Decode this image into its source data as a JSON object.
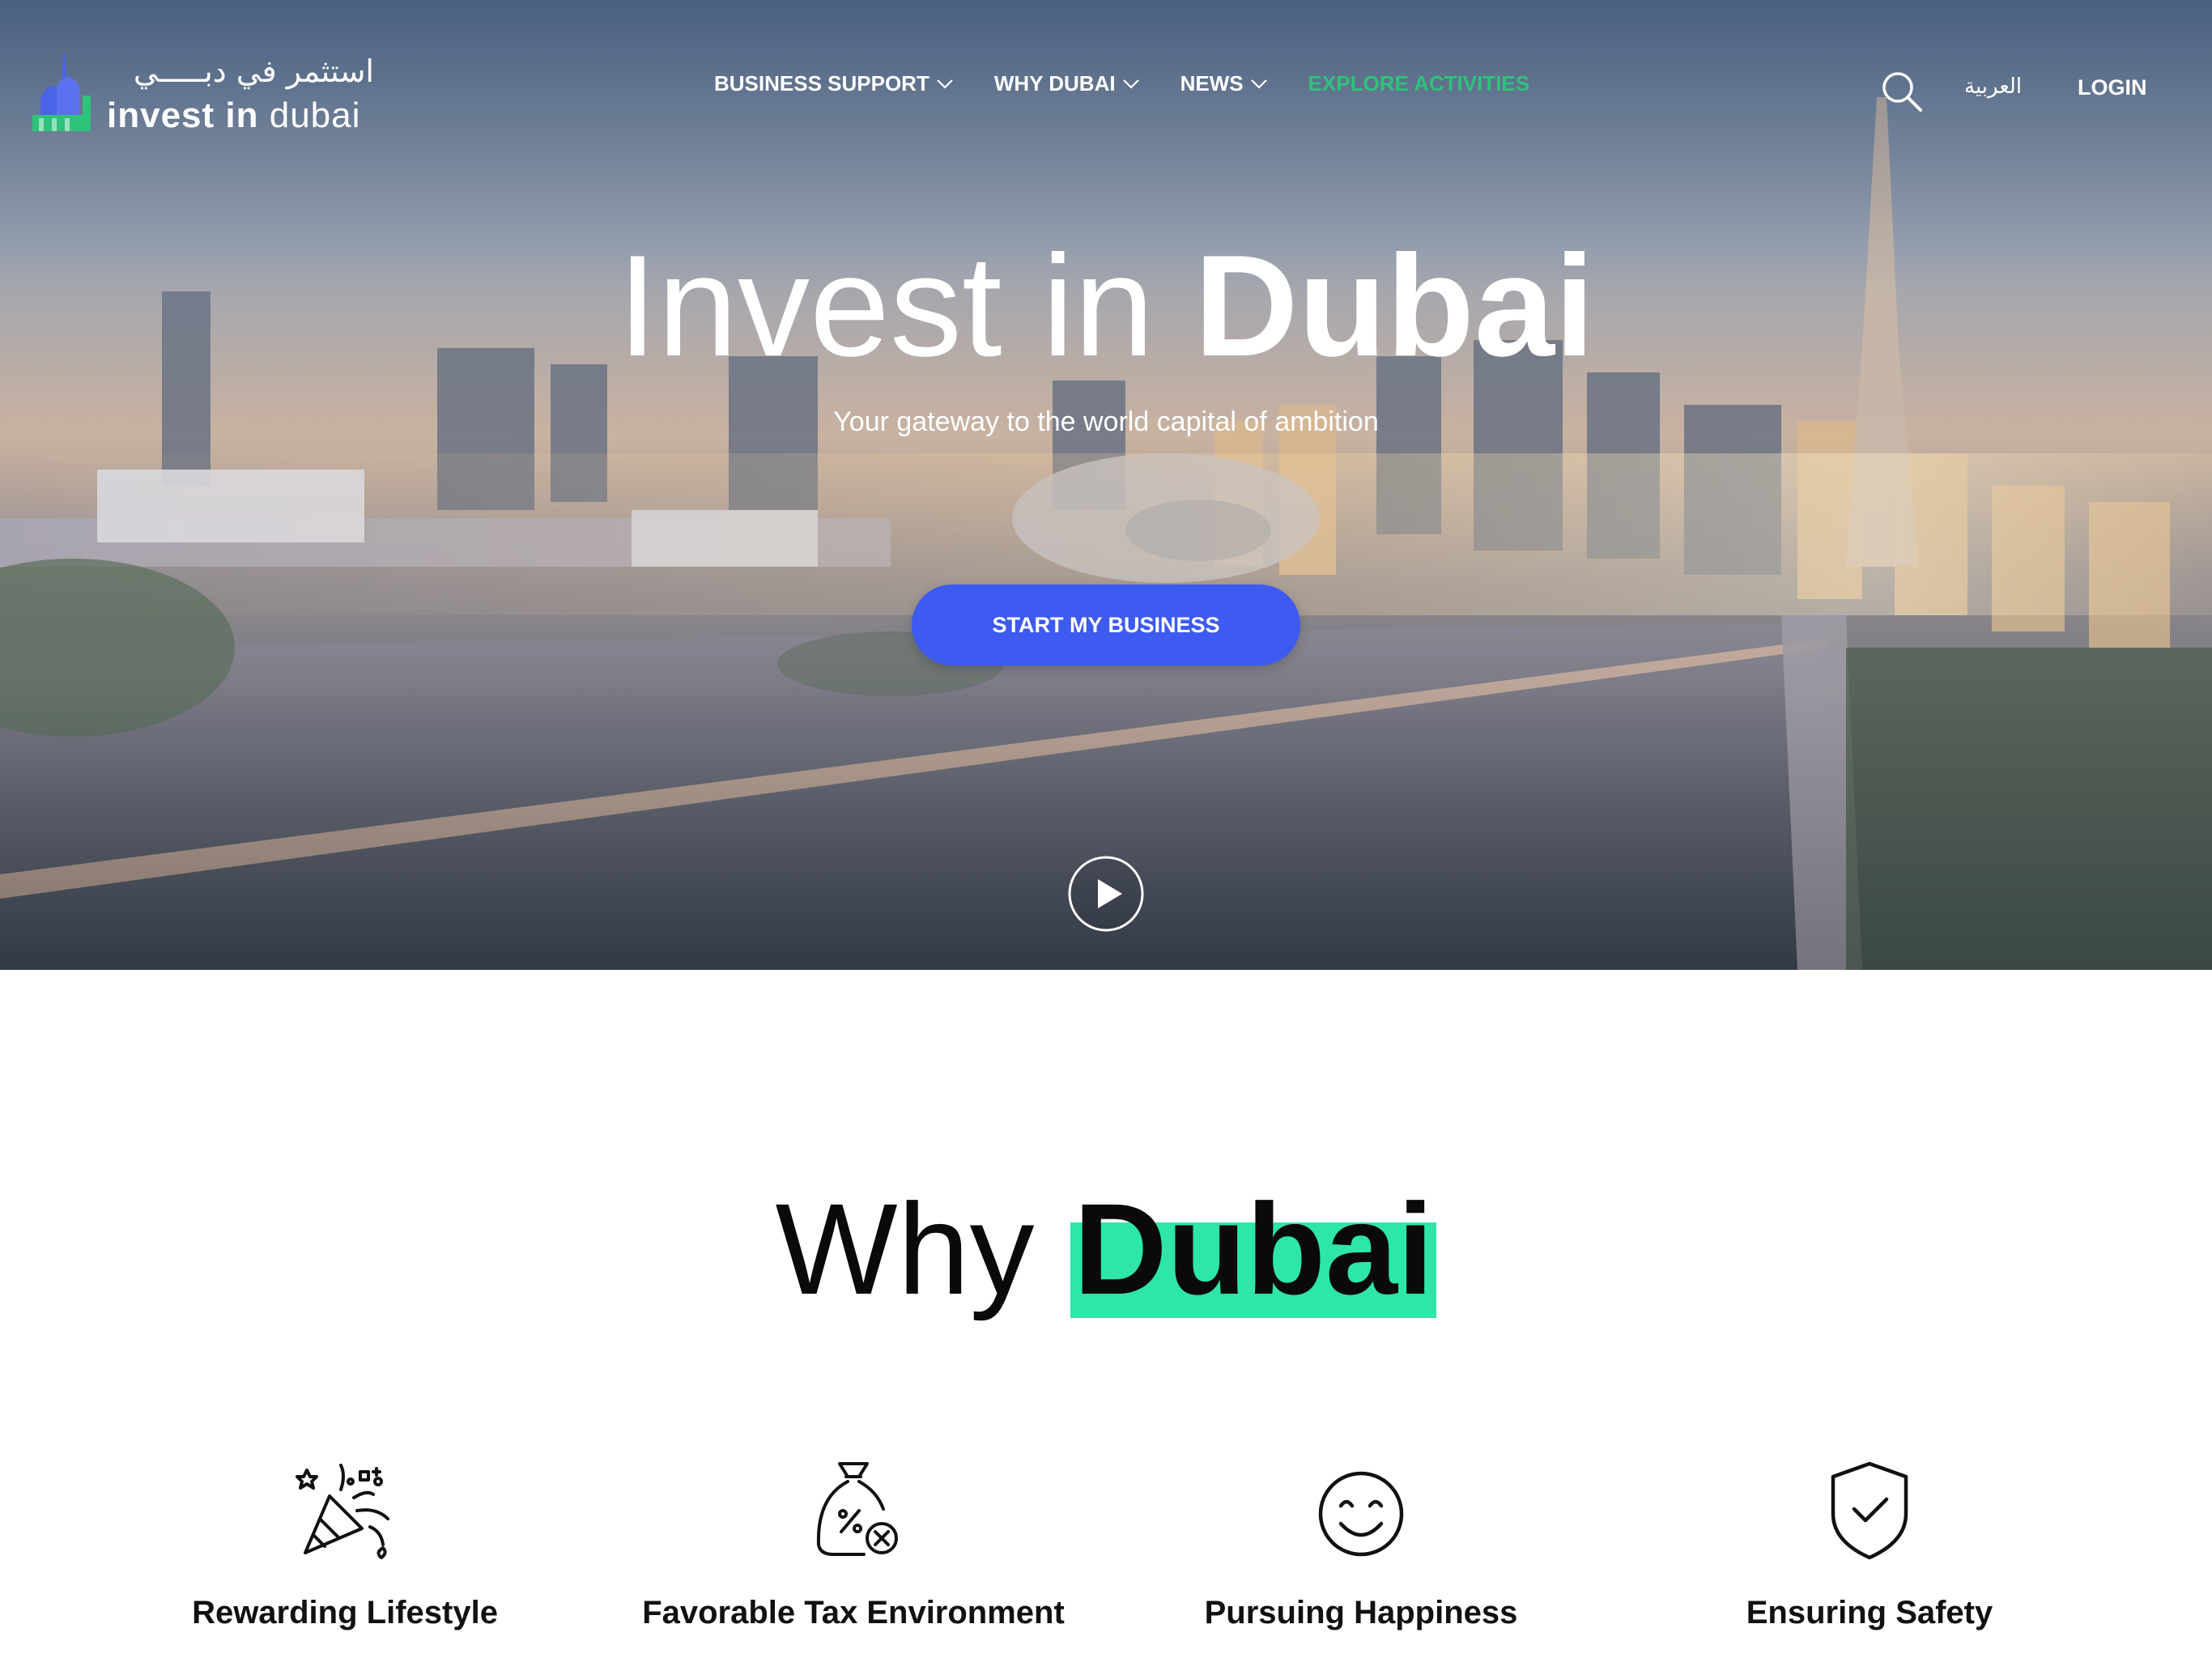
{
  "header": {
    "logo_arabic": "استثمر في دبـــــي",
    "logo_english_strong": "invest in",
    "logo_english_light": "dubai",
    "nav": [
      {
        "label": "BUSINESS SUPPORT",
        "has_dropdown": true
      },
      {
        "label": "WHY DUBAI",
        "has_dropdown": true
      },
      {
        "label": "NEWS",
        "has_dropdown": true
      },
      {
        "label": "EXPLORE ACTIVITIES",
        "has_dropdown": false
      }
    ],
    "language_link": "العربية",
    "login_label": "LOGIN",
    "search_icon": "search-icon"
  },
  "hero": {
    "title_light": "Invest in",
    "title_bold": "Dubai",
    "subtitle": "Your gateway to the world capital of ambition",
    "cta_label": "START MY BUSINESS",
    "play_icon": "play-icon"
  },
  "why": {
    "title_plain": "Why",
    "title_highlight": "Dubai",
    "features": [
      {
        "label": "Rewarding Lifestyle",
        "icon": "celebration-icon"
      },
      {
        "label": "Favorable Tax Environment",
        "icon": "tax-bag-icon"
      },
      {
        "label": "Pursuing Happiness",
        "icon": "smile-icon"
      },
      {
        "label": "Ensuring Safety",
        "icon": "shield-check-icon"
      }
    ]
  },
  "colors": {
    "accent_blue": "#3d5af1",
    "accent_green": "#2fc27a",
    "highlight_green": "#2ee6a6",
    "logo_blue": "#4b63e6"
  }
}
